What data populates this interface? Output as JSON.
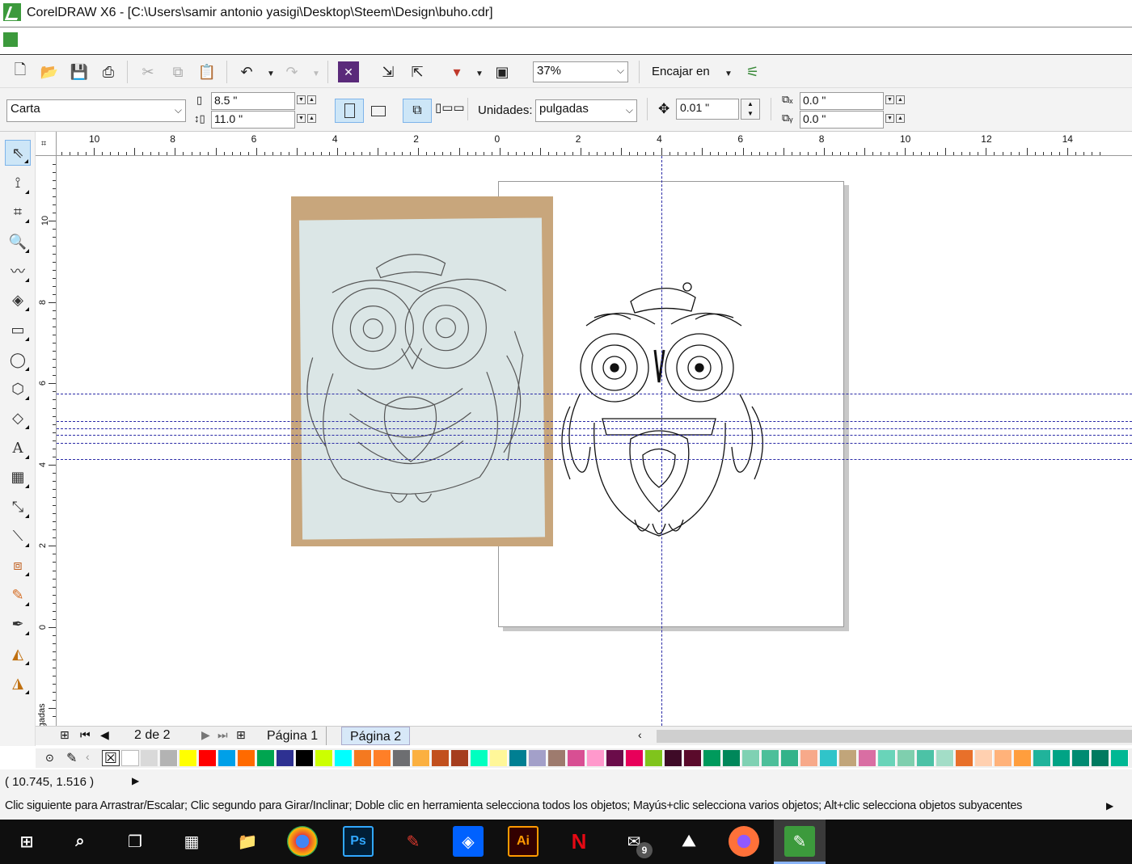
{
  "app": {
    "title": "CorelDRAW X6 - [C:\\Users\\samir antonio yasigi\\Desktop\\Steem\\Design\\buho.cdr]"
  },
  "std_toolbar": {
    "zoom": "37%",
    "snap_label": "Encajar en"
  },
  "prop_toolbar": {
    "page_size": "Carta",
    "width": "8.5 \"",
    "height": "11.0 \"",
    "units_label": "Unidades:",
    "units_value": "pulgadas",
    "nudge": "0.01 \"",
    "dup_x": "0.0 \"",
    "dup_y": "0.0 \""
  },
  "rulers": {
    "h_labels": [
      "10",
      "8",
      "6",
      "4",
      "2",
      "0",
      "2",
      "4",
      "6",
      "8",
      "10",
      "12",
      "14"
    ],
    "v_labels": [
      "10",
      "8",
      "6",
      "4",
      "2",
      "0"
    ],
    "unit_label": "pulgadas"
  },
  "page_nav": {
    "counter": "2 de 2",
    "tabs": [
      "Página 1",
      "Página 2"
    ]
  },
  "palette": {
    "colors": [
      "#ffffff",
      "#d9d9d9",
      "#b3b3b3",
      "#ffff00",
      "#ff0000",
      "#00a0e8",
      "#ff6a00",
      "#00a550",
      "#2e3192",
      "#000000",
      "#ccff00",
      "#00ffff",
      "#f47920",
      "#ff7f27",
      "#6d6e71",
      "#fbb040",
      "#c2501e",
      "#a63d1e",
      "#00ffc0",
      "#fff799",
      "#007f92",
      "#a3a0c9",
      "#9e7b6e",
      "#d84f93",
      "#ff99cc",
      "#6b0c4a",
      "#e8005a",
      "#80c41c",
      "#3e0a27",
      "#5a0a2b",
      "#009a5c",
      "#00875a",
      "#7fd1b3",
      "#4dbf9a",
      "#33b38a",
      "#f7a98a",
      "#30c4c9",
      "#c1a57a",
      "#d96ea3",
      "#69d4b9",
      "#7fcfae",
      "#4cc2a6",
      "#a3ddc7",
      "#e8702a",
      "#ffd0b0",
      "#ffb27a",
      "#ff9e3d",
      "#20b39b",
      "#00a385",
      "#008b72",
      "#007a60",
      "#00b894"
    ]
  },
  "status": {
    "coords": "( 10.745, 1.516 )",
    "hint": "Clic siguiente para Arrastrar/Escalar; Clic segundo para Girar/Inclinar; Doble clic en herramienta selecciona todos los objetos; Mayús+clic selecciona varios objetos; Alt+clic selecciona objetos subyacentes"
  },
  "taskbar": {
    "badge": "9",
    "apps": [
      "windows-start",
      "search",
      "task-view",
      "calculator",
      "file-explorer",
      "chrome",
      "photoshop",
      "acrobat",
      "dropbox",
      "illustrator",
      "netflix",
      "mail",
      "photos",
      "firefox",
      "coreldraw"
    ]
  }
}
